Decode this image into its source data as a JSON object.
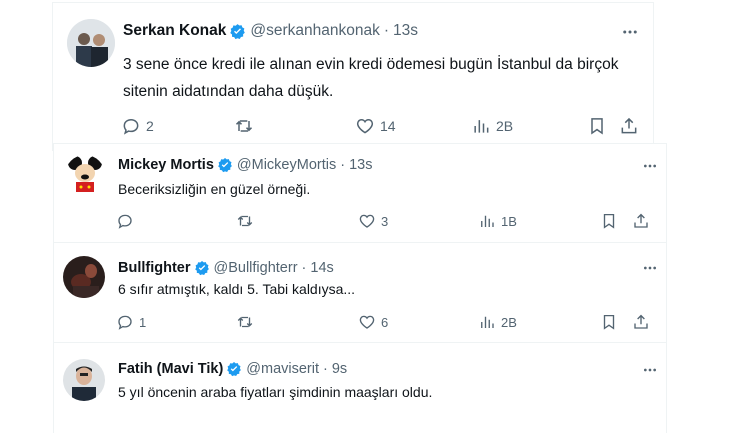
{
  "colors": {
    "verified": "#1d9bf0",
    "muted": "#536471",
    "text": "#0f1419",
    "border": "#eff3f4"
  },
  "icons": {
    "reply": "reply-icon",
    "retweet": "retweet-icon",
    "like": "heart-icon",
    "views": "views-icon",
    "bookmark": "bookmark-icon",
    "share": "share-icon",
    "more": "more-icon",
    "verified": "verified-badge-icon"
  },
  "tweets": [
    {
      "name": "Serkan Konak",
      "handle": "@serkanhankonak",
      "dot": "·",
      "time": "13s",
      "lines": [
        "3 sene önce kredi ile alınan evin kredi ödemesi bugün İstanbul da birçok",
        "sitenin aidatından daha düşük."
      ],
      "replies": "2",
      "retweets": "",
      "likes": "14",
      "views": "2B"
    },
    {
      "name": "Mickey Mortis",
      "handle": "@MickeyMortis",
      "dot": "·",
      "time": "13s",
      "lines": [
        "Beceriksizliğin en güzel örneği."
      ],
      "replies": "",
      "retweets": "",
      "likes": "3",
      "views": "1B"
    },
    {
      "name": "Bullfighter",
      "handle": "@Bullfighterr",
      "dot": "·",
      "time": "14s",
      "lines": [
        "6 sıfır atmıştık, kaldı 5. Tabi kaldıysa..."
      ],
      "replies": "1",
      "retweets": "",
      "likes": "6",
      "views": "2B"
    },
    {
      "name": "Fatih (Mavi Tik)",
      "handle": "@maviserit",
      "dot": "·",
      "time": "9s",
      "lines": [
        "5 yıl öncenin araba fiyatları şimdinin maaşları oldu."
      ],
      "replies": "",
      "retweets": "",
      "likes": "",
      "views": ""
    }
  ]
}
